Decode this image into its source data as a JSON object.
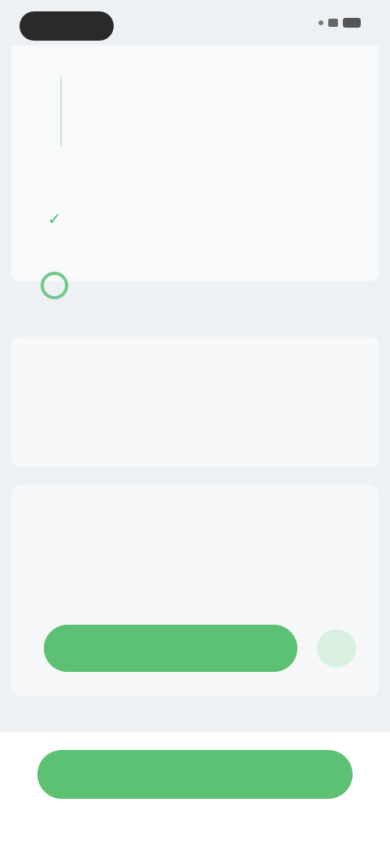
{
  "colors": {
    "accent": "#5cc172",
    "background": "#eef1f4",
    "card": "#f8f9fa"
  },
  "steps": [
    {
      "title": "",
      "subtitle": "",
      "state": "current"
    },
    {
      "title": "",
      "subtitle": "",
      "state": "done"
    },
    {
      "title": "",
      "subtitle": "",
      "state": "pending"
    }
  ],
  "section": {
    "title": ""
  },
  "info": {
    "text": "",
    "link": ""
  },
  "cta": {
    "heading": "",
    "lines": "",
    "primary_label": ""
  },
  "footer": {
    "button_label": ""
  }
}
